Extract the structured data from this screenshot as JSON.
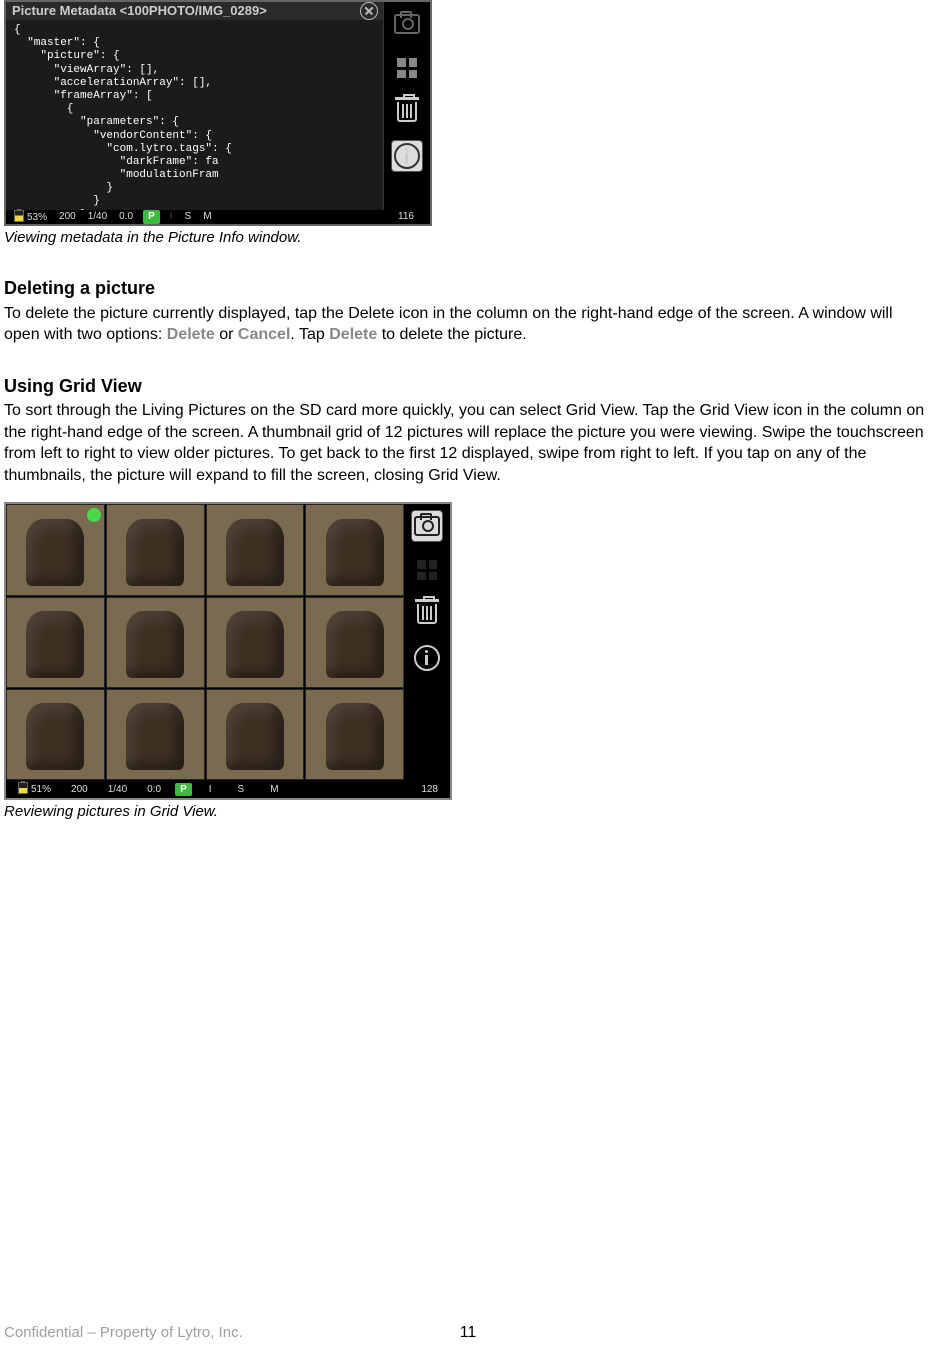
{
  "metadata_window": {
    "title": "Picture Metadata <100PHOTO/IMG_0289>",
    "json_lines": "{\n  \"master\": {\n    \"picture\": {\n      \"viewArray\": [],\n      \"accelerationArray\": [],\n      \"frameArray\": [\n        {\n          \"parameters\": {\n            \"vendorContent\": {\n              \"com.lytro.tags\": {\n                \"darkFrame\": fa\n                \"modulationFram\n              }\n            }\n          }\n        },",
    "status": {
      "battery": "53%",
      "iso": "200",
      "shutter": "1/40",
      "ev": "0.0",
      "mode": "P",
      "s": "S",
      "m": "M",
      "count": "116"
    }
  },
  "caption1": "Viewing metadata in the Picture Info window.",
  "delete_heading": "Deleting a picture",
  "delete_text_pre": "To delete the picture currently displayed, tap the Delete icon in the column on the right-hand edge of the screen. A window will open with two options: ",
  "delete_word1": "Delete",
  "delete_or": " or ",
  "delete_word2": "Cancel",
  "delete_dot": ". Tap ",
  "delete_word3": "Delete",
  "delete_tail": " to delete the picture.",
  "grid_heading": "Using Grid View",
  "grid_text": "To sort through the Living Pictures on the SD card more quickly, you can select Grid View. Tap the Grid View icon in the column on the right-hand edge of the screen. A thumbnail grid of 12 pictures will replace the picture you were viewing. Swipe the touchscreen from left to right to view older pictures. To get back to the first 12 displayed, swipe from right to left. If you tap on any of the thumbnails, the picture will expand to fill the screen, closing Grid View.",
  "grid_status": {
    "battery": "51%",
    "iso": "200",
    "shutter": "1/40",
    "ev": "0:0",
    "mode": "P",
    "i": "I",
    "s": "S",
    "m": "M",
    "count": "128"
  },
  "caption2": "Reviewing pictures in Grid View.",
  "footer_left": "Confidential – Property of Lytro, Inc.",
  "page_number": "11"
}
